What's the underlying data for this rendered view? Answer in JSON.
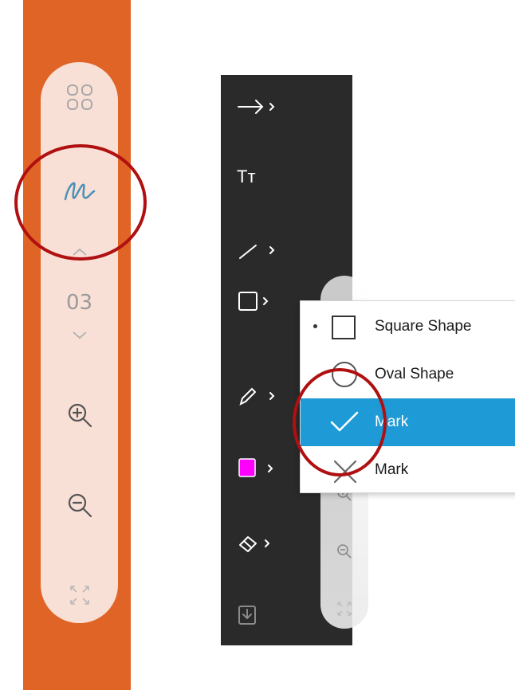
{
  "left_toolbar": {
    "accent_color": "#e06426",
    "pill_color": "#f8e0d6",
    "icons": [
      "grid-icon",
      "pen-scribble-icon",
      "chevron-up-icon",
      "chevron-down-icon",
      "zoom-in-icon",
      "zoom-out-icon",
      "fit-screen-icon"
    ],
    "page_number": "03"
  },
  "dark_toolbar": {
    "background": "#2a2a2a",
    "text_tool_label": "Tт",
    "selected_color": "#ff00ff",
    "icons": [
      "arrow-tool-icon",
      "text-tool-icon",
      "line-tool-icon",
      "shape-tool-icon",
      "pencil-tool-icon",
      "color-swatch-icon",
      "eraser-tool-icon",
      "download-icon"
    ]
  },
  "shape_menu": {
    "items": [
      {
        "label": "Square Shape",
        "icon": "square-icon",
        "selected_dot": true
      },
      {
        "label": "Oval Shape",
        "icon": "oval-icon"
      },
      {
        "label": "Mark",
        "icon": "checkmark-icon",
        "highlighted": true
      },
      {
        "label": "Mark",
        "icon": "x-mark-icon"
      }
    ],
    "highlight_color": "#1e9ad6"
  },
  "annotations": {
    "ring_color": "#b01010"
  }
}
